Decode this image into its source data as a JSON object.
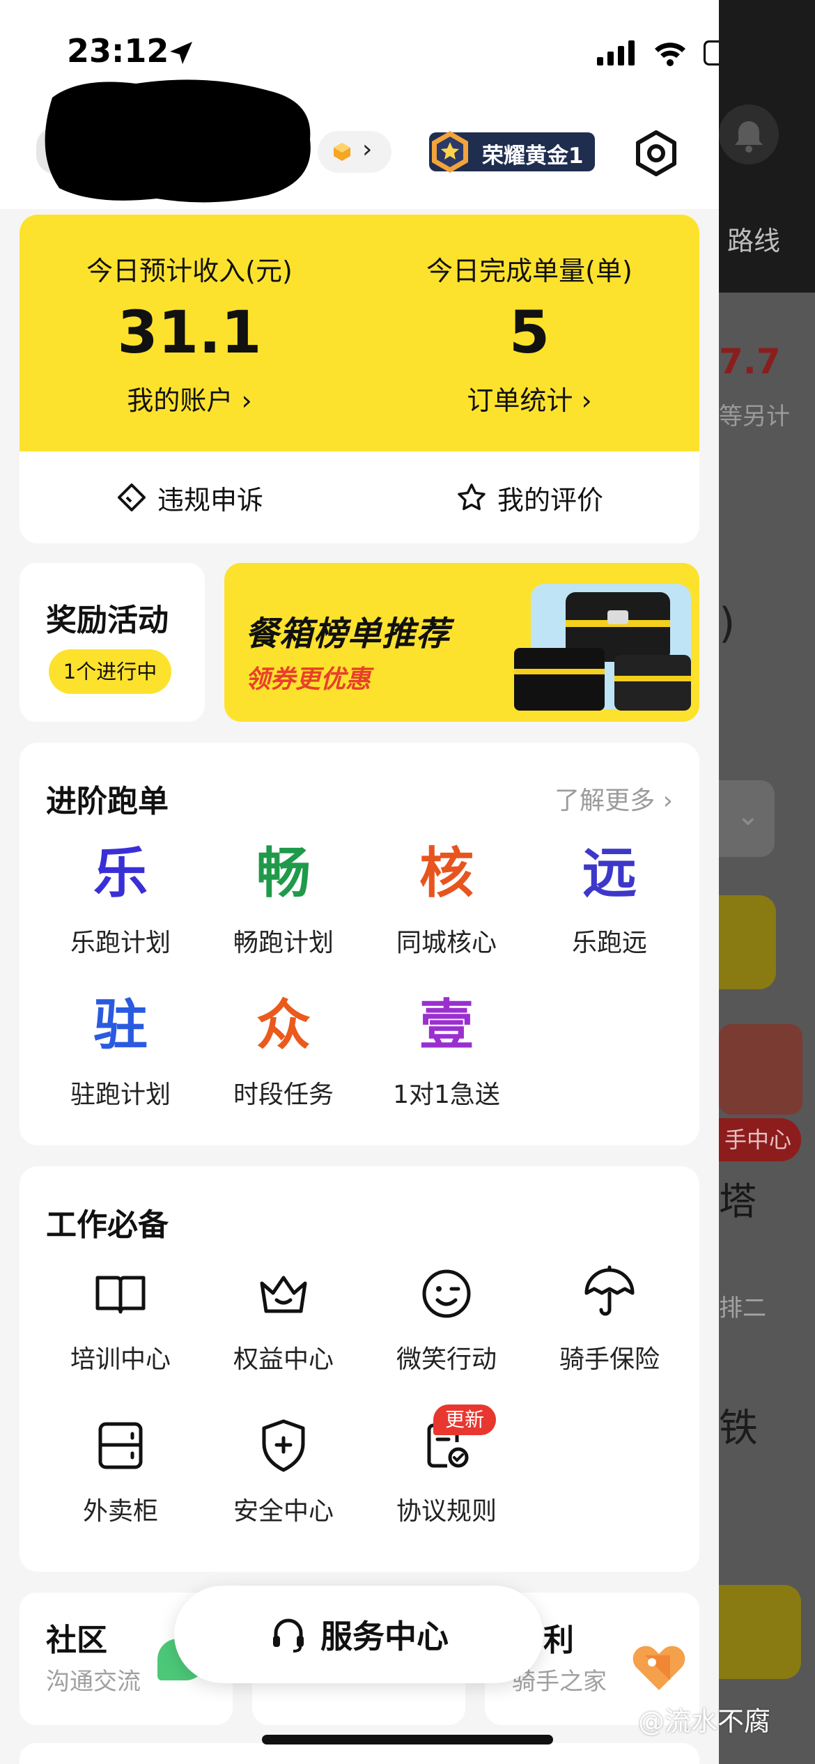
{
  "status_bar": {
    "time": "23:12"
  },
  "header": {
    "rank_badge": "荣耀黄金1"
  },
  "earnings": {
    "income_label": "今日预计收入(元)",
    "income_value": "31.1",
    "income_link": "我的账户 ›",
    "orders_label": "今日完成单量(单)",
    "orders_value": "5",
    "orders_link": "订单统计 ›",
    "appeal": "违规申诉",
    "rating": "我的评价"
  },
  "reward": {
    "title": "奖励活动",
    "pill": "1个进行中"
  },
  "banner": {
    "title": "餐箱榜单推荐",
    "subtitle": "领券更优惠"
  },
  "advanced": {
    "title": "进阶跑单",
    "more": "了解更多 ›",
    "items": [
      {
        "glyph": "乐",
        "label": "乐跑计划",
        "color": "#3a2fd6"
      },
      {
        "glyph": "畅",
        "label": "畅跑计划",
        "color": "#1f9a4a"
      },
      {
        "glyph": "核",
        "label": "同城核心",
        "color": "#e8541e"
      },
      {
        "glyph": "远",
        "label": "乐跑远",
        "color": "#3d38c9"
      },
      {
        "glyph": "驻",
        "label": "驻跑计划",
        "color": "#2a5ae0"
      },
      {
        "glyph": "众",
        "label": "时段任务",
        "color": "#ea5a1d"
      },
      {
        "glyph": "壹",
        "label": "1对1急送",
        "color": "#9a2fd0"
      }
    ]
  },
  "work": {
    "title": "工作必备",
    "items": [
      {
        "icon": "book-icon",
        "label": "培训中心"
      },
      {
        "icon": "crown-icon",
        "label": "权益中心"
      },
      {
        "icon": "smile-icon",
        "label": "微笑行动"
      },
      {
        "icon": "umbrella-icon",
        "label": "骑手保险"
      },
      {
        "icon": "cabinet-icon",
        "label": "外卖柜"
      },
      {
        "icon": "shield-icon",
        "label": "安全中心"
      },
      {
        "icon": "contract-icon",
        "label": "协议规则"
      }
    ],
    "new_badge": "更新"
  },
  "bottom": {
    "community_title": "社区",
    "community_sub": "沟通交流",
    "welfare_title": "利",
    "welfare_sub": "骑手之家",
    "service_center": "服务中心"
  },
  "background_page": {
    "route": "路线",
    "price": "7.7",
    "count_note": "等另计",
    "paren": ")",
    "red_tag": "手中心",
    "tower": "塔",
    "second": "排二",
    "iron": "铁"
  },
  "watermark": "@流水不腐",
  "colors": {
    "brand_yellow": "#fde22d",
    "rank_bg": "#1f2d4f",
    "badge_red": "#e8372e"
  }
}
